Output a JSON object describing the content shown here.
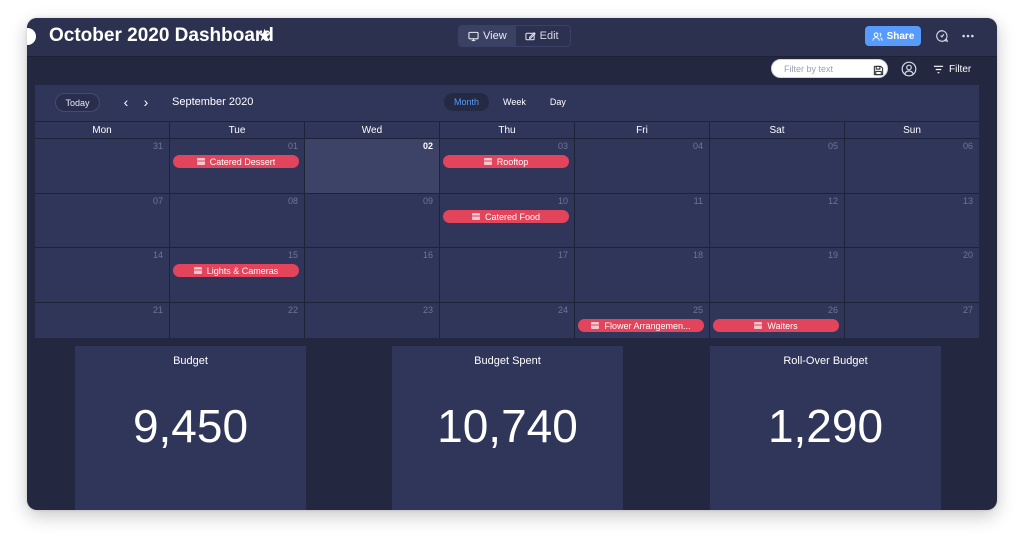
{
  "header": {
    "title": "October 2020 Dashboard",
    "view_toggle": {
      "view_label": "View",
      "edit_label": "Edit"
    },
    "share_label": "Share"
  },
  "toolbar": {
    "filter_placeholder": "Filter by text",
    "filter_label": "Filter"
  },
  "calendar": {
    "today_label": "Today",
    "month_label": "September 2020",
    "view_tabs": [
      {
        "label": "Month",
        "active": true
      },
      {
        "label": "Week",
        "active": false
      },
      {
        "label": "Day",
        "active": false
      }
    ],
    "weekdays": [
      "Mon",
      "Tue",
      "Wed",
      "Thu",
      "Fri",
      "Sat",
      "Sun"
    ],
    "weeks": [
      [
        {
          "num": "31"
        },
        {
          "num": "01",
          "event": "Catered Dessert"
        },
        {
          "num": "02",
          "today": true
        },
        {
          "num": "03",
          "event": "Rooftop"
        },
        {
          "num": "04"
        },
        {
          "num": "05"
        },
        {
          "num": "06"
        }
      ],
      [
        {
          "num": "07"
        },
        {
          "num": "08"
        },
        {
          "num": "09"
        },
        {
          "num": "10",
          "event": "Catered Food"
        },
        {
          "num": "11"
        },
        {
          "num": "12"
        },
        {
          "num": "13"
        }
      ],
      [
        {
          "num": "14"
        },
        {
          "num": "15",
          "event": "Lights & Cameras"
        },
        {
          "num": "16"
        },
        {
          "num": "17"
        },
        {
          "num": "18"
        },
        {
          "num": "19"
        },
        {
          "num": "20"
        }
      ],
      [
        {
          "num": "21"
        },
        {
          "num": "22"
        },
        {
          "num": "23"
        },
        {
          "num": "24"
        },
        {
          "num": "25",
          "event": "Flower Arrangemen..."
        },
        {
          "num": "26",
          "event": "Waiters"
        },
        {
          "num": "27"
        }
      ]
    ],
    "event_color": "#e2445c"
  },
  "widgets": [
    {
      "title": "Budget",
      "value": "9,450"
    },
    {
      "title": "Budget Spent",
      "value": "10,740"
    },
    {
      "title": "Roll-Over Budget",
      "value": "1,290"
    }
  ],
  "colors": {
    "background": "#232840",
    "panel": "#30365a",
    "accent": "#579bfc"
  },
  "icons": [
    "star-icon",
    "monitor-icon",
    "edit-icon",
    "share-person-icon",
    "updates-icon",
    "more-icon",
    "save-icon",
    "person-icon",
    "filter-icon",
    "chevron-left-icon",
    "chevron-right-icon",
    "event-icon"
  ]
}
